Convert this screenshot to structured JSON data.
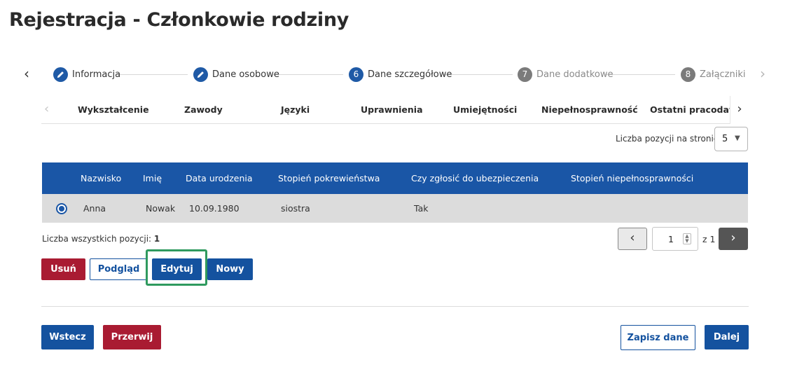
{
  "page": {
    "title": "Rejestracja - Członkowie rodziny"
  },
  "stepper": {
    "steps": [
      {
        "label": "Informacja",
        "state": "done",
        "icon": "pencil-icon"
      },
      {
        "label": "Dane osobowe",
        "state": "done",
        "icon": "pencil-icon"
      },
      {
        "number": "6",
        "label": "Dane szczegółowe",
        "state": "active"
      },
      {
        "number": "7",
        "label": "Dane dodatkowe",
        "state": "pending"
      },
      {
        "number": "8",
        "label": "Załączniki",
        "state": "pending"
      }
    ],
    "prev_icon": "chevron-left-icon",
    "next_icon": "chevron-right-icon"
  },
  "tabs": [
    "Wykształcenie",
    "Zawody",
    "Języki",
    "Uprawnienia",
    "Umiejętności",
    "Niepełnosprawność",
    "Ostatni pracodawca"
  ],
  "per_page": {
    "label": "Liczba pozycji na stronie:",
    "value": "5"
  },
  "table": {
    "columns": [
      "Nazwisko",
      "Imię",
      "Data urodzenia",
      "Stopień pokrewieństwa",
      "Czy zgłosić do ubezpieczenia",
      "Stopień niepełnosprawności"
    ],
    "rows": [
      {
        "nazwisko": "Anna",
        "imie": "Nowak",
        "data": "10.09.1980",
        "pokrewienstwo": "siostra",
        "ubezpieczenie": "Tak",
        "niepelnosprawnosc": ""
      }
    ]
  },
  "total": {
    "label": "Liczba wszystkich pozycji:",
    "value": "1"
  },
  "pagination": {
    "page": "1",
    "of": "z 1"
  },
  "actions": {
    "delete": "Usuń",
    "preview": "Podgląd",
    "edit": "Edytuj",
    "new": "Nowy"
  },
  "footer": {
    "back": "Wstecz",
    "abort": "Przerwij",
    "save": "Zapisz dane",
    "next": "Dalej"
  },
  "colors": {
    "primary": "#14529f",
    "danger": "#a91b32",
    "highlight": "#2f9a5e",
    "table_header": "#1a56a6"
  }
}
